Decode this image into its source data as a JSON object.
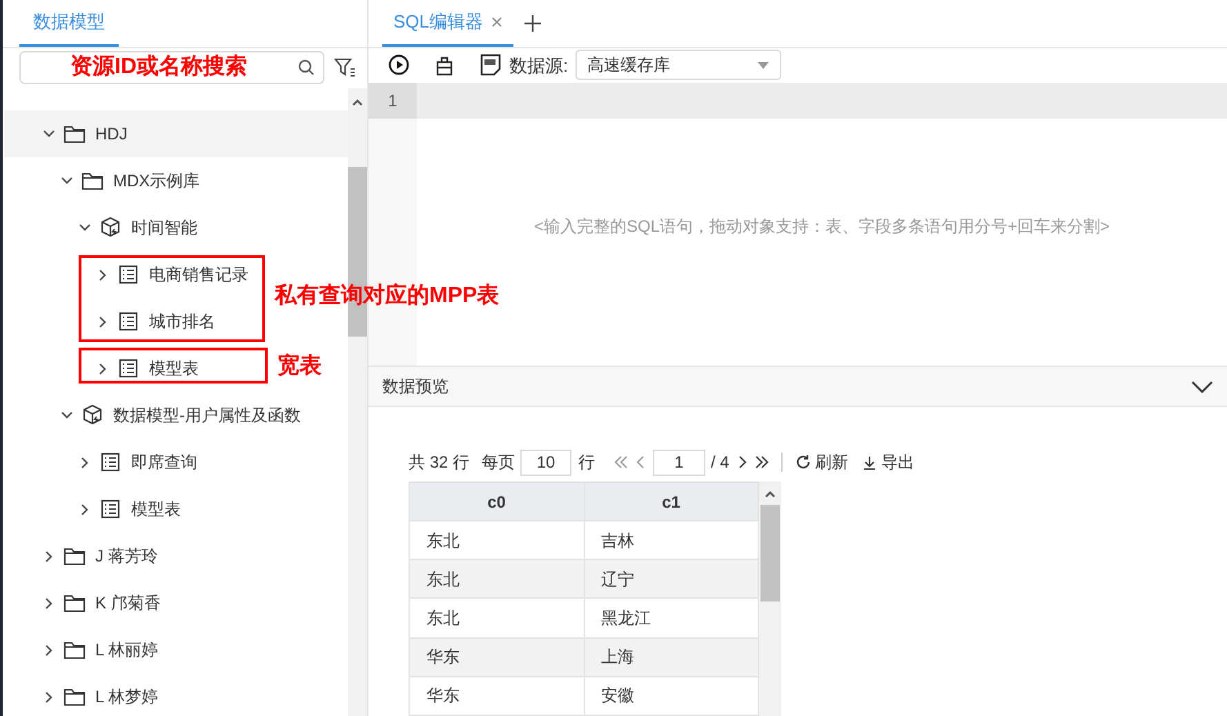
{
  "left_panel": {
    "tab": {
      "label": "数据模型",
      "selected": true
    },
    "search": {
      "placeholder": "资源ID或名称搜索"
    },
    "tree": [
      {
        "label": "HDJ",
        "kind": "folder",
        "expanded": true,
        "selected": true,
        "children": [
          {
            "label": "MDX示例库",
            "kind": "folder",
            "expanded": true,
            "selected": false,
            "children": [
              {
                "label": "时间智能",
                "kind": "cube",
                "expanded": true,
                "selected": false,
                "children": [
                  {
                    "label": "电商销售记录",
                    "kind": "table",
                    "expanded": false,
                    "selected": false
                  },
                  {
                    "label": "城市排名",
                    "kind": "table",
                    "expanded": false,
                    "selected": false
                  },
                  {
                    "label": "模型表",
                    "kind": "table",
                    "expanded": false,
                    "selected": false
                  }
                ]
              }
            ]
          },
          {
            "label": "数据模型-用户属性及函数",
            "kind": "cube",
            "expanded": true,
            "selected": false,
            "children": [
              {
                "label": "即席查询",
                "kind": "table",
                "expanded": false,
                "selected": false
              },
              {
                "label": "模型表",
                "kind": "table",
                "expanded": false,
                "selected": false
              }
            ]
          }
        ]
      },
      {
        "label": "J 蒋芳玲",
        "kind": "folder",
        "expanded": false,
        "selected": false
      },
      {
        "label": "K 邝菊香",
        "kind": "folder",
        "expanded": false,
        "selected": false
      },
      {
        "label": "L 林丽婷",
        "kind": "folder",
        "expanded": false,
        "selected": false
      },
      {
        "label": "L 林梦婷",
        "kind": "folder",
        "expanded": false,
        "selected": false
      }
    ],
    "annotations": [
      {
        "text": "私有查询对应的MPP表"
      },
      {
        "text": "宽表"
      }
    ]
  },
  "editor": {
    "tabs": [
      {
        "label": "SQL编辑器",
        "selected": true
      }
    ],
    "datasource_label": "数据源:",
    "datasource": "高速缓存库",
    "line_numbers": [
      "1"
    ],
    "placeholder": "<输入完整的SQL语句，拖动对象支持：表、字段多条语句用分号+回车来分割>"
  },
  "preview": {
    "title": "数据预览",
    "total": "共 32 行",
    "per_page_label": "每页",
    "per_page": "10",
    "rows_unit": "行",
    "page": "1",
    "page_total": "/ 4",
    "refresh": "刷新",
    "export": "导出",
    "table": {
      "columns": [
        "c0",
        "c1"
      ],
      "rows": [
        [
          "东北",
          "吉林"
        ],
        [
          "东北",
          "辽宁"
        ],
        [
          "东北",
          "黑龙江"
        ],
        [
          "华东",
          "上海"
        ],
        [
          "华东",
          "安徽"
        ]
      ]
    }
  }
}
